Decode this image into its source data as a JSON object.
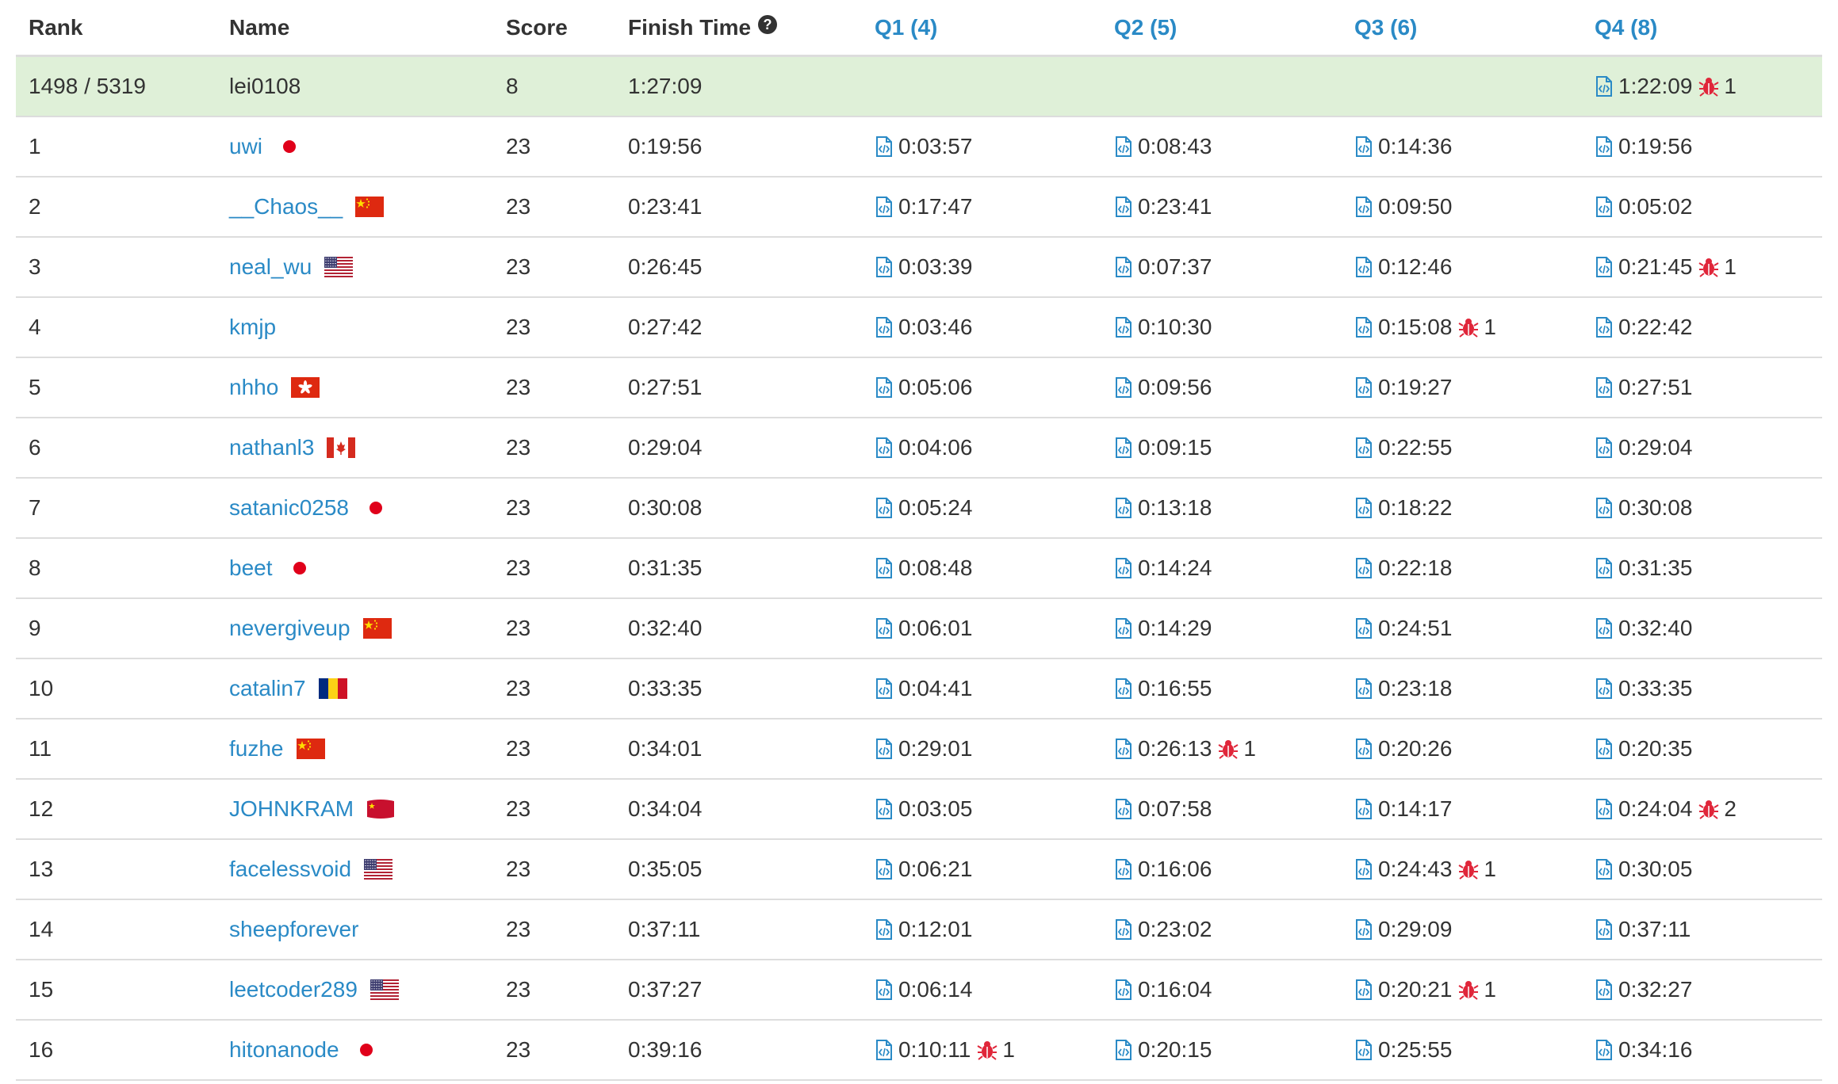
{
  "colors": {
    "link": "#2a8ac6",
    "highlight_row": "#dff0d8",
    "bug": "#e0263a",
    "border": "#dddddd"
  },
  "header": {
    "rank": "Rank",
    "name": "Name",
    "score": "Score",
    "finish_time": "Finish Time",
    "finish_time_icon": "question-circle-icon",
    "q1": "Q1 (4)",
    "q2": "Q2 (5)",
    "q3": "Q3 (6)",
    "q4": "Q4 (8)"
  },
  "my_row": {
    "rank": "1498 / 5319",
    "name": "lei0108",
    "score": "8",
    "finish_time": "1:27:09",
    "q1": null,
    "q2": null,
    "q3": null,
    "q4": {
      "time": "1:22:09",
      "bugs": "1"
    }
  },
  "rows": [
    {
      "rank": "1",
      "name": "uwi",
      "flag": "jp",
      "score": "23",
      "finish_time": "0:19:56",
      "q1": {
        "time": "0:03:57"
      },
      "q2": {
        "time": "0:08:43"
      },
      "q3": {
        "time": "0:14:36"
      },
      "q4": {
        "time": "0:19:56"
      }
    },
    {
      "rank": "2",
      "name": "__Chaos__",
      "flag": "cn",
      "score": "23",
      "finish_time": "0:23:41",
      "q1": {
        "time": "0:17:47"
      },
      "q2": {
        "time": "0:23:41"
      },
      "q3": {
        "time": "0:09:50"
      },
      "q4": {
        "time": "0:05:02"
      }
    },
    {
      "rank": "3",
      "name": "neal_wu",
      "flag": "us",
      "score": "23",
      "finish_time": "0:26:45",
      "q1": {
        "time": "0:03:39"
      },
      "q2": {
        "time": "0:07:37"
      },
      "q3": {
        "time": "0:12:46"
      },
      "q4": {
        "time": "0:21:45",
        "bugs": "1"
      }
    },
    {
      "rank": "4",
      "name": "kmjp",
      "flag": null,
      "score": "23",
      "finish_time": "0:27:42",
      "q1": {
        "time": "0:03:46"
      },
      "q2": {
        "time": "0:10:30"
      },
      "q3": {
        "time": "0:15:08",
        "bugs": "1"
      },
      "q4": {
        "time": "0:22:42"
      }
    },
    {
      "rank": "5",
      "name": "nhho",
      "flag": "hk",
      "score": "23",
      "finish_time": "0:27:51",
      "q1": {
        "time": "0:05:06"
      },
      "q2": {
        "time": "0:09:56"
      },
      "q3": {
        "time": "0:19:27"
      },
      "q4": {
        "time": "0:27:51"
      }
    },
    {
      "rank": "6",
      "name": "nathanl3",
      "flag": "ca",
      "score": "23",
      "finish_time": "0:29:04",
      "q1": {
        "time": "0:04:06"
      },
      "q2": {
        "time": "0:09:15"
      },
      "q3": {
        "time": "0:22:55"
      },
      "q4": {
        "time": "0:29:04"
      }
    },
    {
      "rank": "7",
      "name": "satanic0258",
      "flag": "jp",
      "score": "23",
      "finish_time": "0:30:08",
      "q1": {
        "time": "0:05:24"
      },
      "q2": {
        "time": "0:13:18"
      },
      "q3": {
        "time": "0:18:22"
      },
      "q4": {
        "time": "0:30:08"
      }
    },
    {
      "rank": "8",
      "name": "beet",
      "flag": "jp",
      "score": "23",
      "finish_time": "0:31:35",
      "q1": {
        "time": "0:08:48"
      },
      "q2": {
        "time": "0:14:24"
      },
      "q3": {
        "time": "0:22:18"
      },
      "q4": {
        "time": "0:31:35"
      }
    },
    {
      "rank": "9",
      "name": "nevergiveup",
      "flag": "cn",
      "score": "23",
      "finish_time": "0:32:40",
      "q1": {
        "time": "0:06:01"
      },
      "q2": {
        "time": "0:14:29"
      },
      "q3": {
        "time": "0:24:51"
      },
      "q4": {
        "time": "0:32:40"
      }
    },
    {
      "rank": "10",
      "name": "catalin7",
      "flag": "ro",
      "score": "23",
      "finish_time": "0:33:35",
      "q1": {
        "time": "0:04:41"
      },
      "q2": {
        "time": "0:16:55"
      },
      "q3": {
        "time": "0:23:18"
      },
      "q4": {
        "time": "0:33:35"
      }
    },
    {
      "rank": "11",
      "name": "fuzhe",
      "flag": "cn",
      "score": "23",
      "finish_time": "0:34:01",
      "q1": {
        "time": "0:29:01"
      },
      "q2": {
        "time": "0:26:13",
        "bugs": "1"
      },
      "q3": {
        "time": "0:20:26"
      },
      "q4": {
        "time": "0:20:35"
      }
    },
    {
      "rank": "12",
      "name": "JOHNKRAM",
      "flag": "cn-wave",
      "score": "23",
      "finish_time": "0:34:04",
      "q1": {
        "time": "0:03:05"
      },
      "q2": {
        "time": "0:07:58"
      },
      "q3": {
        "time": "0:14:17"
      },
      "q4": {
        "time": "0:24:04",
        "bugs": "2"
      }
    },
    {
      "rank": "13",
      "name": "facelessvoid",
      "flag": "us",
      "score": "23",
      "finish_time": "0:35:05",
      "q1": {
        "time": "0:06:21"
      },
      "q2": {
        "time": "0:16:06"
      },
      "q3": {
        "time": "0:24:43",
        "bugs": "1"
      },
      "q4": {
        "time": "0:30:05"
      }
    },
    {
      "rank": "14",
      "name": "sheepforever",
      "flag": null,
      "score": "23",
      "finish_time": "0:37:11",
      "q1": {
        "time": "0:12:01"
      },
      "q2": {
        "time": "0:23:02"
      },
      "q3": {
        "time": "0:29:09"
      },
      "q4": {
        "time": "0:37:11"
      }
    },
    {
      "rank": "15",
      "name": "leetcoder289",
      "flag": "us",
      "score": "23",
      "finish_time": "0:37:27",
      "q1": {
        "time": "0:06:14"
      },
      "q2": {
        "time": "0:16:04"
      },
      "q3": {
        "time": "0:20:21",
        "bugs": "1"
      },
      "q4": {
        "time": "0:32:27"
      }
    },
    {
      "rank": "16",
      "name": "hitonanode",
      "flag": "jp",
      "score": "23",
      "finish_time": "0:39:16",
      "q1": {
        "time": "0:10:11",
        "bugs": "1"
      },
      "q2": {
        "time": "0:20:15"
      },
      "q3": {
        "time": "0:25:55"
      },
      "q4": {
        "time": "0:34:16"
      }
    }
  ]
}
